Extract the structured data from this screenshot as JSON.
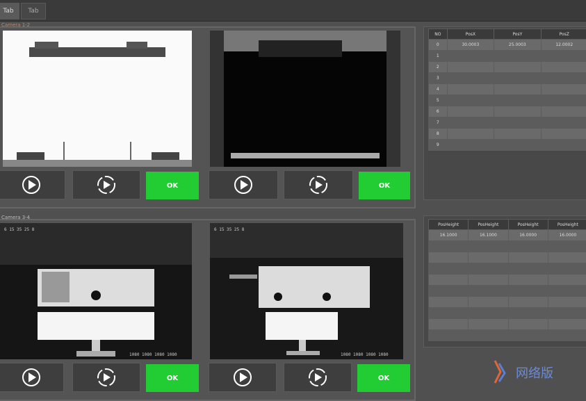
{
  "tabs": [
    {
      "label": "Tab"
    },
    {
      "label": "Tab"
    }
  ],
  "top_group_label": "Camera 1-2",
  "bottom_group_label": "Camera 3-4",
  "ok_label": "OK",
  "coord_text": "1080  1080  1080  1080",
  "tick_text": "6   15   35   25   8",
  "top_table": {
    "headers": [
      "NO",
      "PosX",
      "PosY",
      "PosZ"
    ],
    "rows": [
      [
        "0",
        "30.0003",
        "25.0003",
        "12.0002"
      ],
      [
        "1",
        "",
        "",
        ""
      ],
      [
        "2",
        "",
        "",
        ""
      ],
      [
        "3",
        "",
        "",
        ""
      ],
      [
        "4",
        "",
        "",
        ""
      ],
      [
        "5",
        "",
        "",
        ""
      ],
      [
        "6",
        "",
        "",
        ""
      ],
      [
        "7",
        "",
        "",
        ""
      ],
      [
        "8",
        "",
        "",
        ""
      ],
      [
        "9",
        "",
        "",
        ""
      ]
    ]
  },
  "bottom_table": {
    "headers": [
      "PosHeight",
      "PosHeight",
      "PosHeight",
      "PosHeight"
    ],
    "rows": [
      [
        "16.1000",
        "16.1000",
        "16.0000",
        "16.0000"
      ],
      [
        "",
        "",
        "",
        ""
      ],
      [
        "",
        "",
        "",
        ""
      ],
      [
        "",
        "",
        "",
        ""
      ],
      [
        "",
        "",
        "",
        ""
      ],
      [
        "",
        "",
        "",
        ""
      ],
      [
        "",
        "",
        "",
        ""
      ],
      [
        "",
        "",
        "",
        ""
      ],
      [
        "",
        "",
        "",
        ""
      ],
      [
        "",
        "",
        "",
        ""
      ]
    ]
  },
  "watermark_text": "网络版"
}
